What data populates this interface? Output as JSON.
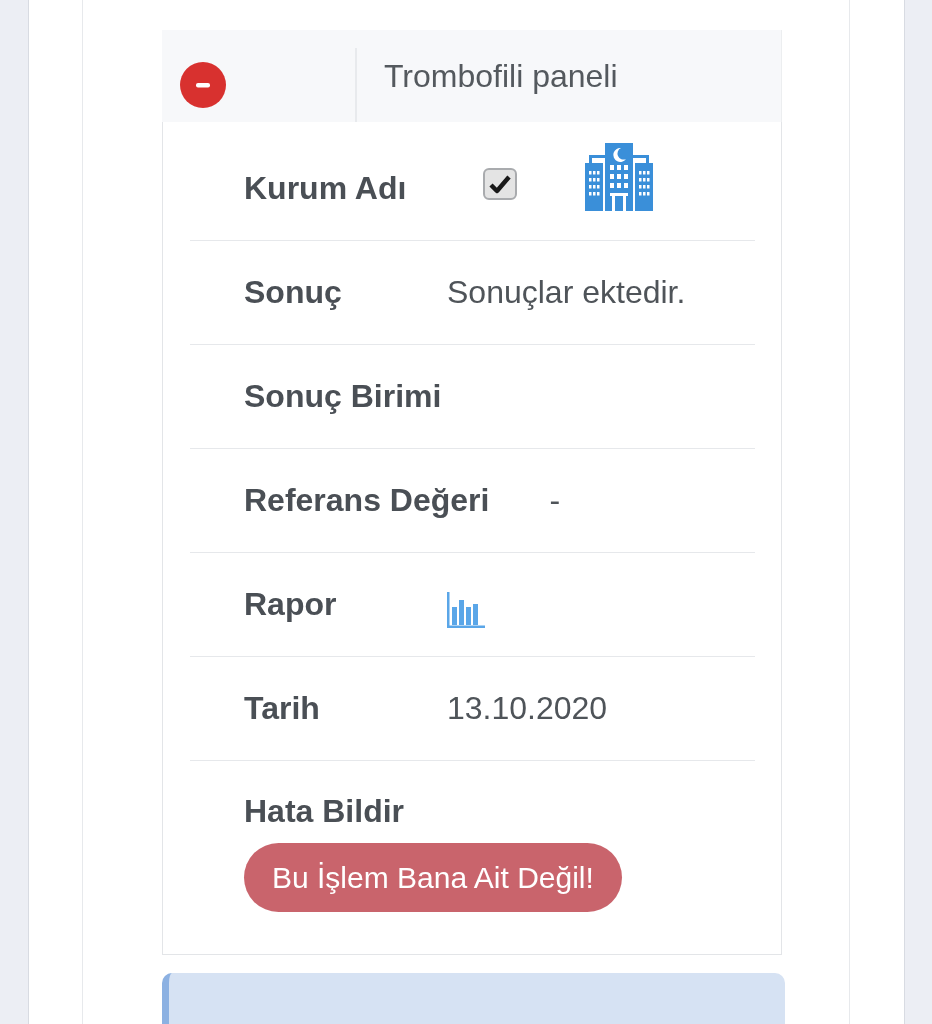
{
  "panel": {
    "title": "Trombofili paneli",
    "expanded": true
  },
  "fields": [
    {
      "kind": "checkbox",
      "label": "Kurum Adı",
      "checked": true
    },
    {
      "kind": "text",
      "label": "Sonuç",
      "value": "Sonuçlar ektedir."
    },
    {
      "kind": "text",
      "label": "Sonuç Birimi"
    },
    {
      "kind": "text",
      "label": "Referans Değeri",
      "value": "-"
    },
    {
      "kind": "report",
      "label": "Rapor"
    },
    {
      "kind": "text",
      "label": "Tarih",
      "value": "13.10.2020"
    },
    {
      "kind": "action",
      "label": "Hata Bildir",
      "button": "Bu İşlem Bana Ait Değil!"
    }
  ]
}
